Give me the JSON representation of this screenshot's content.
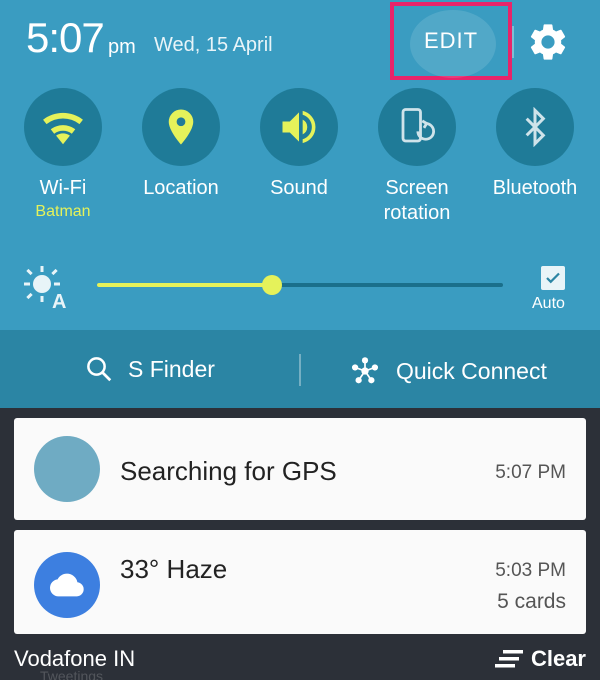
{
  "status": {
    "time": "5:07",
    "ampm": "pm",
    "date": "Wed, 15 April"
  },
  "header": {
    "edit_label": "EDIT",
    "settings_icon": "gear-icon"
  },
  "tiles": [
    {
      "label": "Wi-Fi",
      "sub": "Batman",
      "icon": "wifi-icon",
      "active": true
    },
    {
      "label": "Location",
      "sub": "",
      "icon": "location-pin-icon",
      "active": true
    },
    {
      "label": "Sound",
      "sub": "",
      "icon": "speaker-icon",
      "active": true
    },
    {
      "label": "Screen rotation",
      "sub": "",
      "icon": "screen-rotation-icon",
      "active": false
    },
    {
      "label": "Bluetooth",
      "sub": "",
      "icon": "bluetooth-icon",
      "active": false
    }
  ],
  "brightness": {
    "level": 0.43,
    "auto_label": "Auto",
    "auto_checked": true,
    "icon": "auto-brightness-icon"
  },
  "actions": {
    "finder_label": "S Finder",
    "quick_connect_label": "Quick Connect"
  },
  "notifications": [
    {
      "title": "Searching for GPS",
      "time": "5:07 PM",
      "extra": ""
    },
    {
      "title": "33° Haze",
      "time": "5:03 PM",
      "extra": "5 cards",
      "icon": "cloud-icon"
    }
  ],
  "footer": {
    "carrier": "Vodafone IN",
    "ghost_text": "Tweetings",
    "clear_label": "Clear"
  },
  "colors": {
    "shade": "#3a9cc1",
    "tile_bg": "#1f7b98",
    "accent": "#e5f25a",
    "highlight": "#e8246a"
  }
}
